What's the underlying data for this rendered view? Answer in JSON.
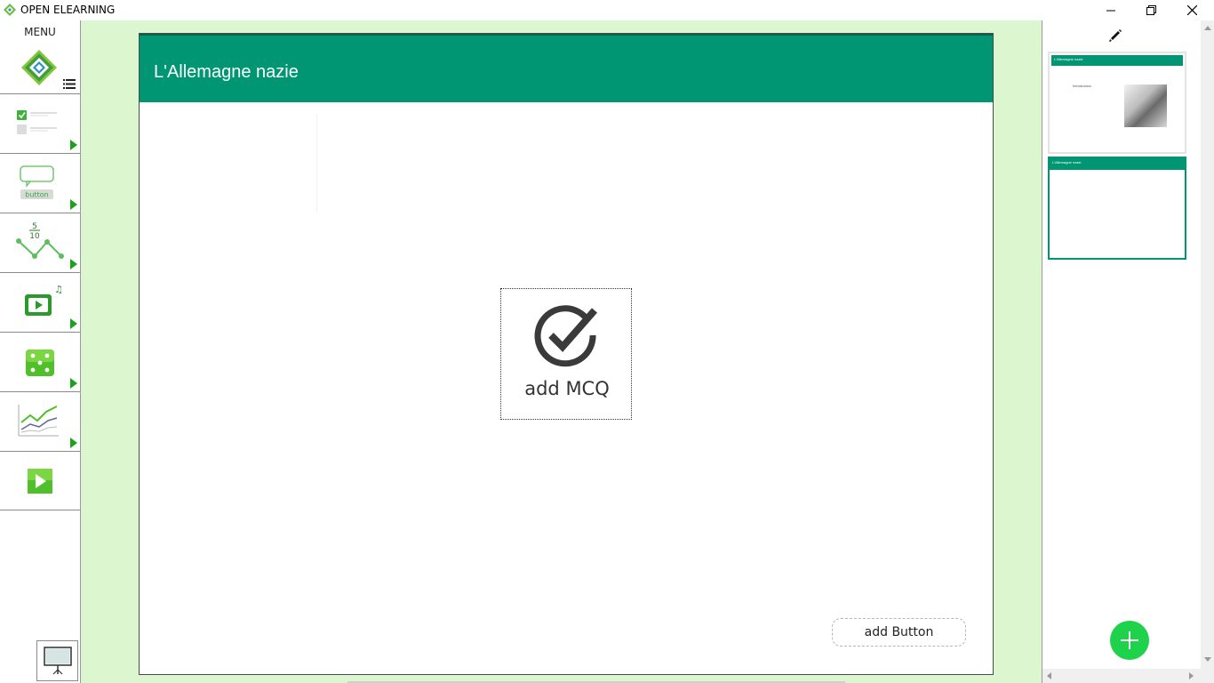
{
  "window": {
    "title": "OPEN ELEARNING",
    "icon": "app-logo-icon",
    "controls": [
      "minimize-icon",
      "restore-icon",
      "close-icon"
    ]
  },
  "left_toolbar": {
    "menu_label": "MENU",
    "logo": "app-logo-icon",
    "tools": [
      {
        "name": "quiz-tool",
        "icon": "checkbox-list-icon"
      },
      {
        "name": "button-tool",
        "icon": "speech-button-icon",
        "text": "button"
      },
      {
        "name": "score-tool",
        "icon": "score-graph-icon",
        "numerator": "5",
        "denominator": "10"
      },
      {
        "name": "media-tool",
        "icon": "video-music-icon"
      },
      {
        "name": "game-tool",
        "icon": "dice-icon"
      },
      {
        "name": "chart-tool",
        "icon": "line-chart-icon"
      },
      {
        "name": "play-tool",
        "icon": "play-icon"
      }
    ],
    "present_icon": "presentation-icon"
  },
  "slide": {
    "title": "L'Allemagne nazie",
    "mcq_label": "add MCQ",
    "add_button_label": "add Button"
  },
  "right_panel": {
    "edit_icon": "pencil-icon",
    "thumbnails": [
      {
        "title": "L'Allemagne nazie",
        "subtitle": "Introduction",
        "has_image": true
      },
      {
        "title": "L'Allemagne nazie",
        "selected": true
      }
    ],
    "add_icon": "plus-icon"
  },
  "colors": {
    "accent": "#009673",
    "workspace_bg": "#dcf6d0",
    "tool_green": "#18a418",
    "add_button": "#1ed24b"
  }
}
